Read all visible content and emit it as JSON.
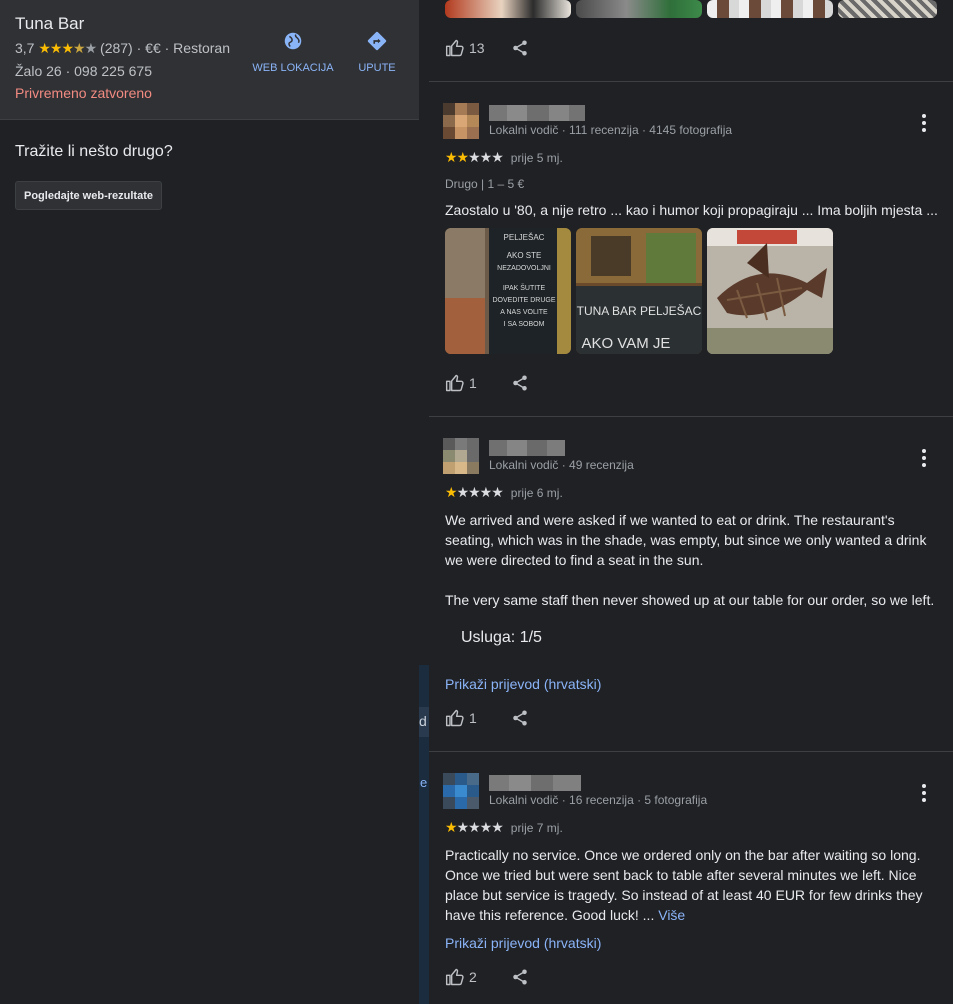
{
  "place": {
    "name": "Tuna Bar",
    "rating": "3,7",
    "stars_on": "★★★",
    "stars_half": "★",
    "stars_off": "★",
    "reviews_count": "(287)",
    "price_category": " · €€ · Restoran",
    "address": "Žalo 26 · 098 225 675",
    "status": "Privremeno zatvoreno",
    "actions": {
      "website": "WEB LOKACIJA",
      "directions": "UPUTE"
    }
  },
  "sidebar": {
    "search_prompt": "Tražite li nešto drugo?",
    "web_results_button": "Pogledajte web-rezultate"
  },
  "map_strip": {
    "text1": "d",
    "text2": "e"
  },
  "reviews": [
    {
      "likes": "13"
    },
    {
      "meta": "Lokalni vodič · 111 recenzija · 4145 fotografija",
      "stars": 2,
      "stars_on": "★★",
      "stars_off": "★★★",
      "when": "prije 5 mj.",
      "sub": "Drugo  |  1 – 5 €",
      "text": "Zaostalo u '80, a nije retro ... kao i humor koji propagiraju ... Ima boljih mjesta ...",
      "likes": "1"
    },
    {
      "meta": "Lokalni vodič · 49 recenzija",
      "stars": 1,
      "stars_on": "★",
      "stars_off": "★★★★",
      "when": "prije 6 mj.",
      "para1": "We arrived and were asked if we wanted to eat or drink. The restaurant's seating, which was in the shade, was empty, but since we only wanted a drink we were directed to find a seat in the sun.",
      "para2": "The very same staff then never showed up at our table for our order, so we left.",
      "service": "Usluga: 1/5",
      "translate": "Prikaži prijevod (hrvatski)",
      "likes": "1"
    },
    {
      "meta": "Lokalni vodič · 16 recenzija · 5 fotografija",
      "stars": 1,
      "stars_on": "★",
      "stars_off": "★★★★",
      "when": "prije 7 mj.",
      "text": "Practically no service. Once we ordered only on the bar after waiting so long. Once we tried but were sent back to table after several minutes we left. Nice place but service is tragedy. So instead of at least 40 EUR for few drinks they have this reference. Good luck! ...",
      "more": "Više",
      "translate": "Prikaži prijevod (hrvatski)",
      "likes": "2"
    }
  ],
  "photo_sign_texts": {
    "sign1": [
      "PELJEŠAC",
      "AKO STE",
      "NEZADOVOLJNI",
      "IPAK ŠUTITE",
      "DOVEDITE DRUGE",
      "A NAS VOLITE",
      "I SA SOBOM"
    ],
    "sign2": [
      "TUNA BAR PELJEŠAC",
      "AKO VAM JE"
    ]
  },
  "colors": {
    "accent": "#8ab4f8",
    "star": "#fbbc04",
    "closed": "#f28b82",
    "bg": "#202124"
  }
}
